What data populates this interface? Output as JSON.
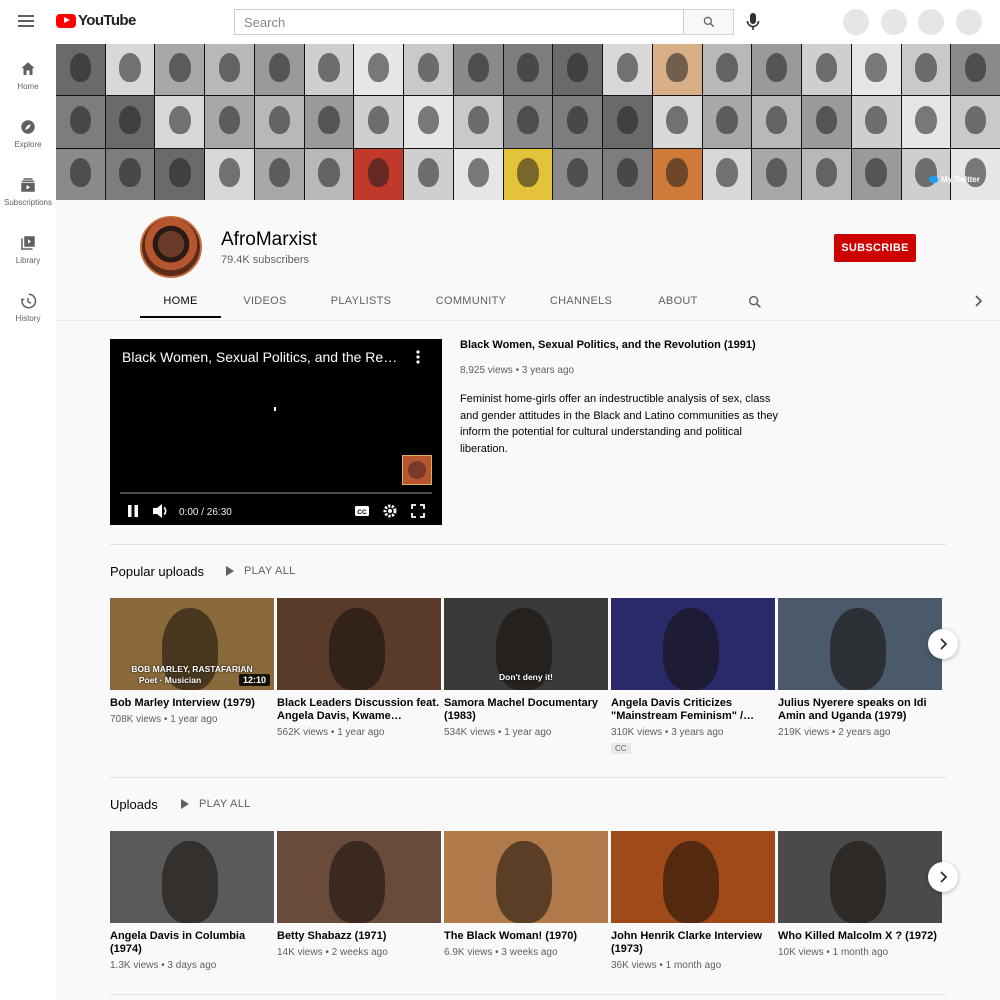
{
  "app": {
    "logo_text": "YouTube",
    "search_placeholder": "Search",
    "brand_red": "#ff0000"
  },
  "sidebar": {
    "items": [
      {
        "label": "Home",
        "icon": "home-icon"
      },
      {
        "label": "Explore",
        "icon": "compass-icon"
      },
      {
        "label": "Subscriptions",
        "icon": "subscriptions-icon"
      },
      {
        "label": "Library",
        "icon": "library-icon"
      },
      {
        "label": "History",
        "icon": "history-icon"
      }
    ]
  },
  "banner": {
    "twitter_link": "My Twitter"
  },
  "channel": {
    "name": "AfroMarxist",
    "subscribers": "79.4K subscribers",
    "subscribe_label": "SUBSCRIBE",
    "subscribe_color": "#cc0000"
  },
  "tabs": [
    "HOME",
    "VIDEOS",
    "PLAYLISTS",
    "COMMUNITY",
    "CHANNELS",
    "ABOUT"
  ],
  "featured": {
    "player_title": "Black Women, Sexual Politics, and the Revolution (1991)",
    "time": "0:00 / 26:30",
    "title": "Black Women, Sexual Politics, and the Revolution (1991)",
    "meta": "8,925 views • 3 years ago",
    "description": "Feminist home-girls offer an indestructible analysis of sex, class and gender attitudes in the Black and Latino communities as they inform the potential for cultural understanding and political liberation."
  },
  "popular": {
    "title": "Popular uploads",
    "play_all": "PLAY ALL",
    "videos": [
      {
        "title": "Bob Marley Interview (1979)",
        "meta": "708K views • 1 year ago",
        "duration": "12:10",
        "caption": "BOB MARLEY, RASTAFARIAN",
        "caption2": "Poet · Musician",
        "bg": "#8a6a3a"
      },
      {
        "title": "Black Leaders Discussion feat. Angela Davis, Kwame…",
        "meta": "562K views • 1 year ago",
        "bg": "#5a3a2a"
      },
      {
        "title": "Samora Machel Documentary (1983)",
        "meta": "534K views • 1 year ago",
        "caption": "Don't deny it!",
        "bg": "#3a3a3a"
      },
      {
        "title": "Angela Davis Criticizes \"Mainstream Feminism\" /…",
        "meta": "310K views • 3 years ago",
        "badge": "CC",
        "bg": "#2a2a6a"
      },
      {
        "title": "Julius Nyerere speaks on Idi Amin and Uganda (1979)",
        "meta": "219K views • 2 years ago",
        "bg": "#4a5a6a"
      }
    ]
  },
  "uploads": {
    "title": "Uploads",
    "play_all": "PLAY ALL",
    "videos": [
      {
        "title": "Angela Davis in Columbia (1974)",
        "meta": "1.3K views • 3 days ago",
        "bg": "#5a5a5a"
      },
      {
        "title": "Betty Shabazz (1971)",
        "meta": "14K views • 2 weeks ago",
        "bg": "#6a4a3a"
      },
      {
        "title": "The Black Woman! (1970)",
        "meta": "6.9K views • 3 weeks ago",
        "bg": "#b07a4a"
      },
      {
        "title": "John Henrik Clarke Interview (1973)",
        "meta": "36K views • 1 month ago",
        "bg": "#a04a1a"
      },
      {
        "title": "Who Killed Malcolm X ? (1972)",
        "meta": "10K views • 1 month ago",
        "bg": "#4a4a4a"
      }
    ]
  }
}
